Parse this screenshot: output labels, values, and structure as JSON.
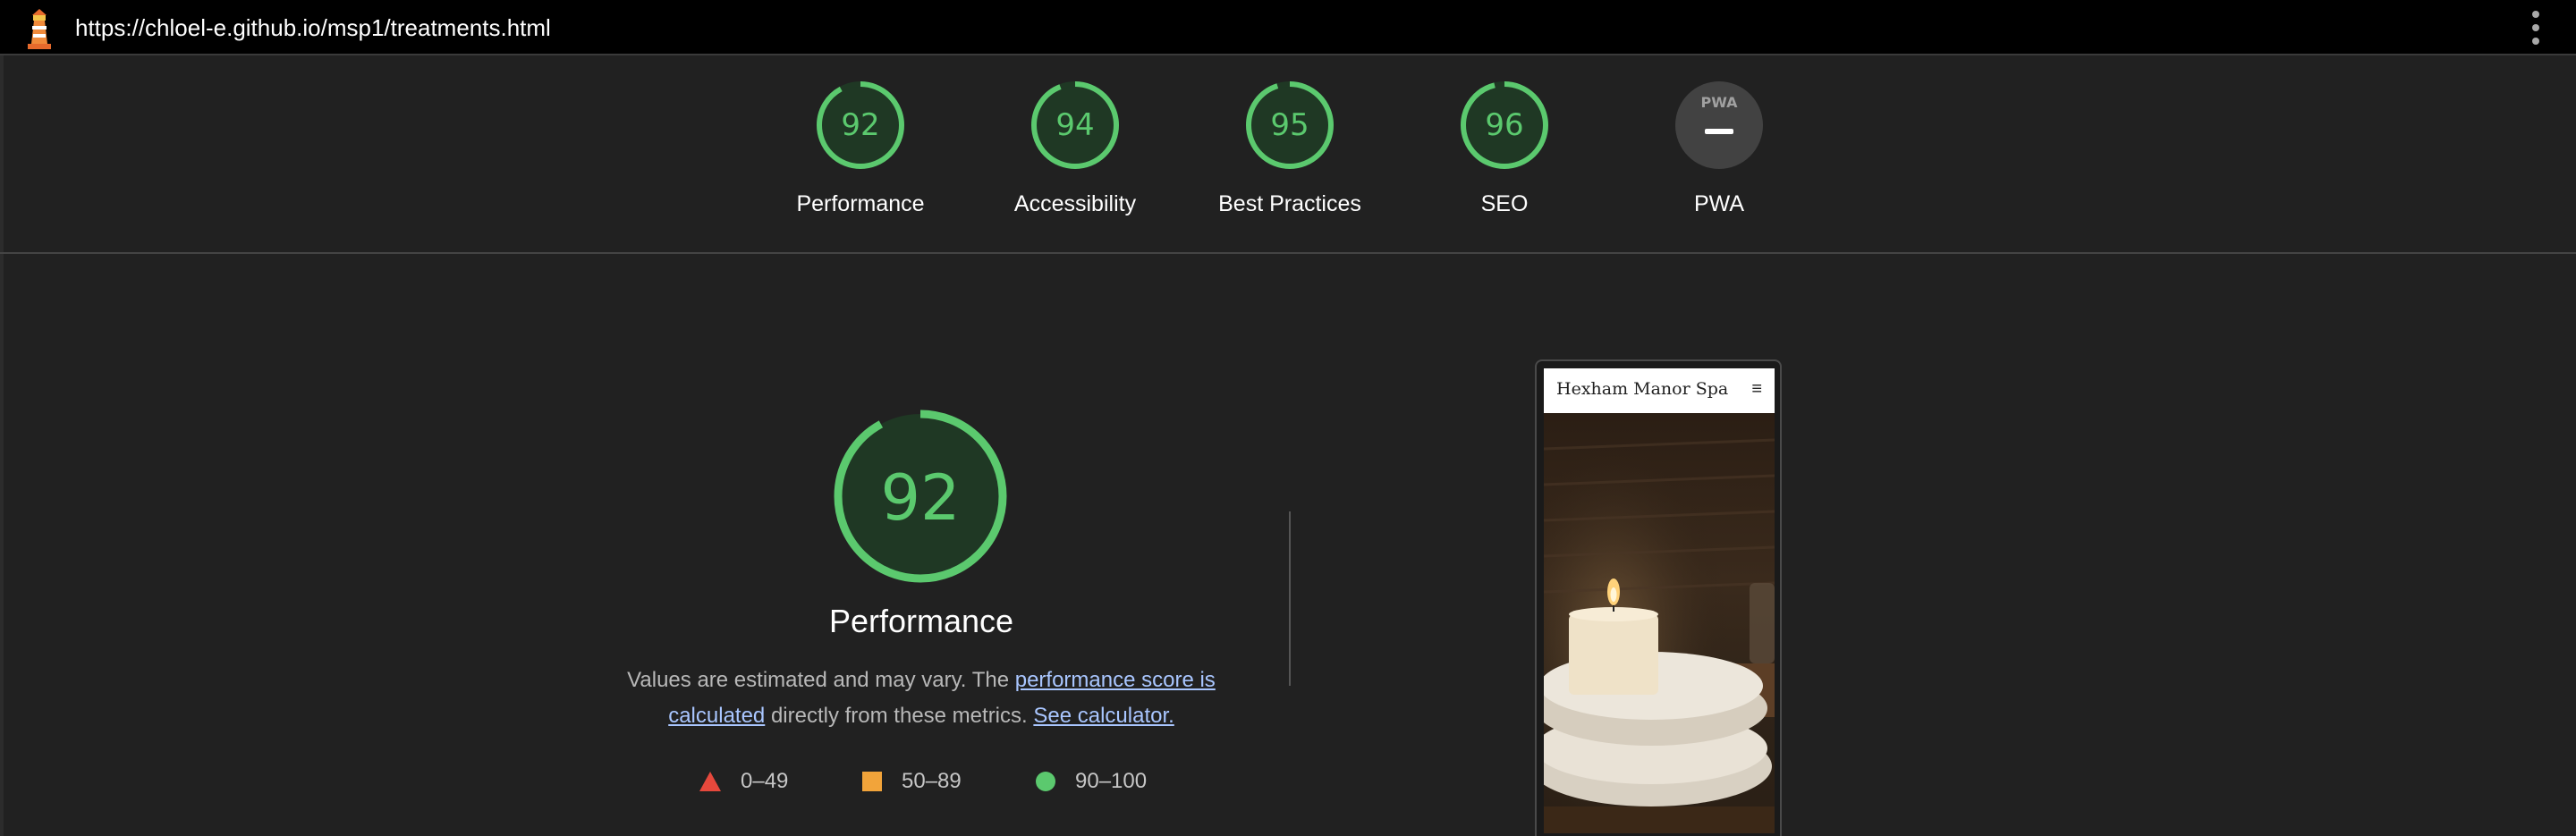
{
  "browser": {
    "url": "https://chloel-e.github.io/msp1/treatments.html",
    "logo_icon": "lighthouse-icon",
    "menu_icon": "kebab-menu-icon"
  },
  "scores": [
    {
      "label": "Performance",
      "value": "92",
      "score": 0.92
    },
    {
      "label": "Accessibility",
      "value": "94",
      "score": 0.94
    },
    {
      "label": "Best Practices",
      "value": "95",
      "score": 0.95
    },
    {
      "label": "SEO",
      "value": "96",
      "score": 0.96
    },
    {
      "label": "PWA",
      "value": "PWA",
      "score": null
    }
  ],
  "performance": {
    "value": "92",
    "score": 0.92,
    "title": "Performance",
    "desc_prefix": "Values are estimated and may vary. The ",
    "desc_link1": "performance score is calculated",
    "desc_middle": " directly from these metrics. ",
    "desc_link2": "See calculator.",
    "legend": [
      {
        "range": "0–49",
        "shape": "triangle",
        "color": "#e6483c"
      },
      {
        "range": "50–89",
        "shape": "square",
        "color": "#f2a43a"
      },
      {
        "range": "90–100",
        "shape": "circle",
        "color": "#5bc96e"
      }
    ]
  },
  "screenshot": {
    "brand": "Hexham Manor Spa",
    "menu_icon": "hamburger-menu-icon"
  },
  "colors": {
    "pass": "#5bc96e",
    "pass_track": "#1f3824",
    "background": "#212121"
  }
}
